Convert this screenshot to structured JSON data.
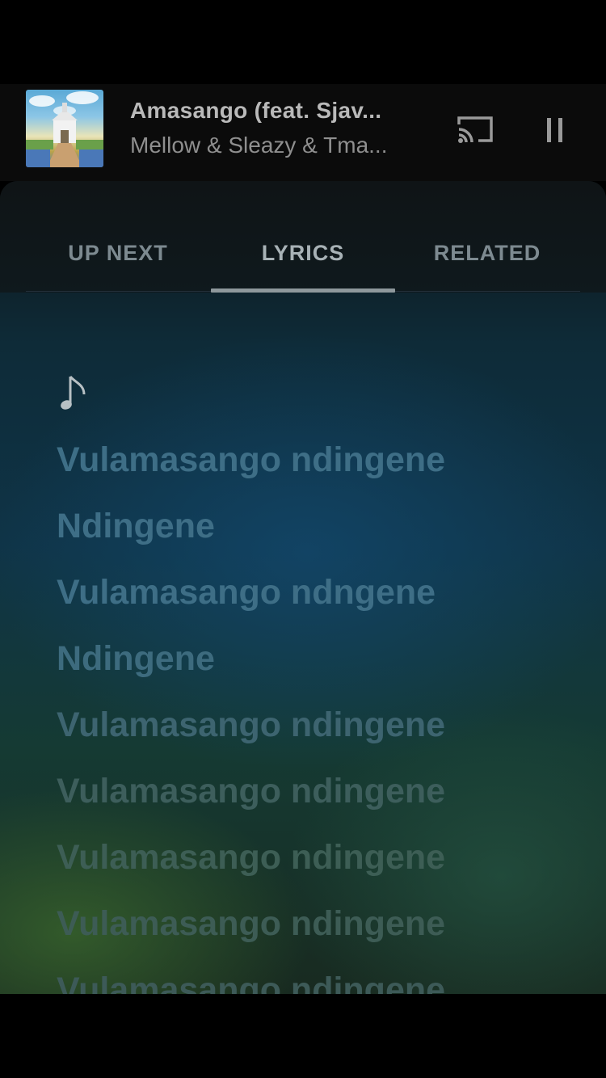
{
  "now_playing": {
    "title": "Amasango (feat. Sjav...",
    "artist": "Mellow & Sleazy & Tma..."
  },
  "tabs": [
    {
      "label": "UP NEXT",
      "active": false
    },
    {
      "label": "LYRICS",
      "active": true
    },
    {
      "label": "RELATED",
      "active": false
    }
  ],
  "lyrics": {
    "note_symbol": "♪",
    "lines": [
      "Vulamasango ndingene",
      "Ndingene",
      "Vulamasango ndngene",
      "Ndingene",
      "Vulamasango ndingene",
      "Vulamasango ndingene",
      "Vulamasango ndingene",
      "Vulamasango ndingene",
      "Vulamasango ndingene"
    ]
  },
  "icons": {
    "cast": "cast-icon",
    "pause": "pause-icon",
    "note": "music-note-icon"
  },
  "colors": {
    "lyric_blue": "#3e6e86",
    "lyric_green": "#3d5e52"
  }
}
